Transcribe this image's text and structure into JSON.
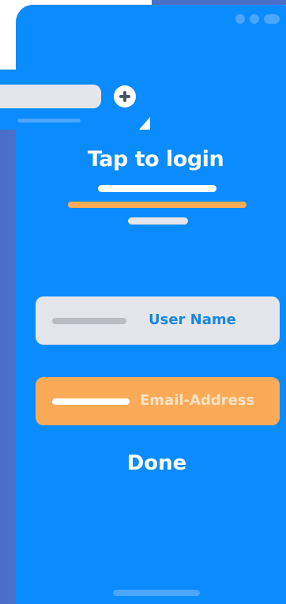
{
  "screen": {
    "title": "Tap to login"
  },
  "fields": {
    "username_label": "User Name",
    "email_label": "Email-Address"
  },
  "actions": {
    "done_label": "Done"
  },
  "colors": {
    "primary": "#0a8cff",
    "accent": "#fbab57",
    "field_light": "#e4e6eb",
    "frame": "#4b6fc8"
  },
  "icons": {
    "add": "plus-icon",
    "window_controls": "window-dots-icon"
  }
}
